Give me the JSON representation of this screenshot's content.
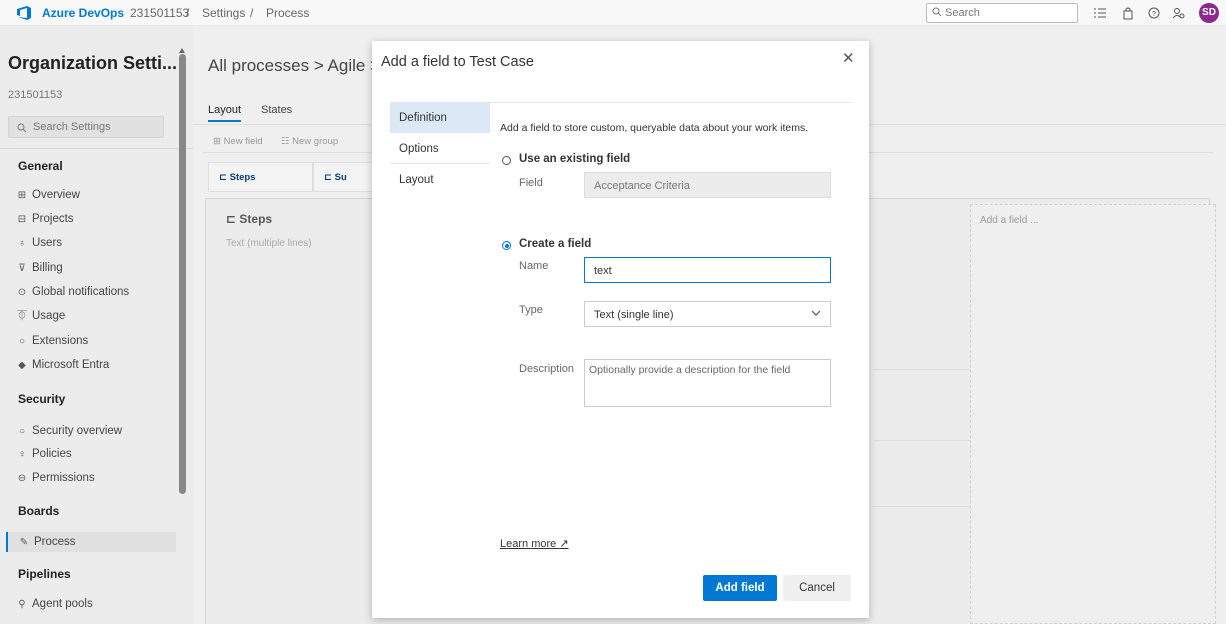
{
  "topbar": {
    "brand": "Azure DevOps",
    "org": "231501153",
    "separator": "/",
    "crumb1": "Settings",
    "crumb2": "Process",
    "search_placeholder": "Search",
    "avatar_initials": "SD"
  },
  "sidebar": {
    "title": "Organization Setti...",
    "subtitle": "231501153",
    "search_placeholder": "Search Settings",
    "sections": {
      "general": "General",
      "security": "Security",
      "boards": "Boards",
      "pipelines": "Pipelines"
    },
    "items": {
      "overview": "Overview",
      "projects": "Projects",
      "users": "Users",
      "billing": "Billing",
      "notifications": "Global notifications",
      "usage": "Usage",
      "extensions": "Extensions",
      "entra": "Microsoft Entra",
      "security_overview": "Security overview",
      "policies": "Policies",
      "permissions": "Permissions",
      "process": "Process",
      "agent_pools": "Agent pools"
    }
  },
  "main": {
    "header_title": "All processes > Agile >",
    "tabs": [
      "Layout",
      "States"
    ],
    "toolbar": [
      "New field",
      "New group"
    ],
    "group_tabs": [
      "Steps",
      "Su"
    ],
    "steps_title": "Steps",
    "steps_sub": "Text (multiple lines)",
    "add_field_placeholder": "Add a field ..."
  },
  "dialog": {
    "title": "Add a field to Test Case",
    "nav": [
      "Definition",
      "Options",
      "Layout"
    ],
    "intro": "Add a field to store custom, queryable data about your work items.",
    "use_existing_label": "Use an existing field",
    "field_label": "Field",
    "field_value": "Acceptance Criteria",
    "create_label": "Create a field",
    "name_label": "Name",
    "name_value": "text",
    "type_label": "Type",
    "type_value": "Text (single line)",
    "description_label": "Description",
    "description_placeholder": "Optionally provide a description for the field",
    "learn_more": "Learn more",
    "add_button": "Add field",
    "cancel_button": "Cancel"
  },
  "colors": {
    "accent": "#0078d4",
    "avatar_bg": "#8a2a8f"
  }
}
